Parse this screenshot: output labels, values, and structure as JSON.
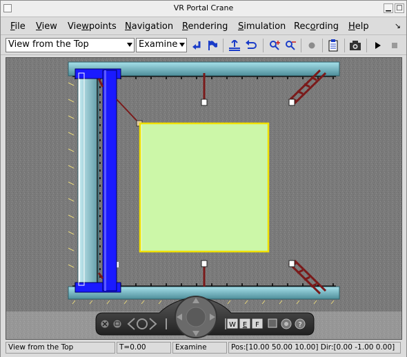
{
  "window": {
    "title": "VR Portal Crane"
  },
  "menu": {
    "file": {
      "mnemonic": "F",
      "rest": "ile"
    },
    "view": {
      "mnemonic": "V",
      "rest": "iew"
    },
    "viewpoints": {
      "pre": "Vie",
      "mnemonic": "w",
      "rest": "points"
    },
    "navigation": {
      "mnemonic": "N",
      "rest": "avigation"
    },
    "rendering": {
      "mnemonic": "R",
      "rest": "endering"
    },
    "simulation": {
      "mnemonic": "S",
      "rest": "imulation"
    },
    "recording": {
      "pre": "Rec",
      "mnemonic": "o",
      "rest": "rding"
    },
    "help": {
      "mnemonic": "H",
      "rest": "elp"
    }
  },
  "toolbar": {
    "viewpoint_select": "View from the Top",
    "navmode_select": "Examine"
  },
  "navpanel": {
    "w_label": "W",
    "e_label": "E",
    "f_label": "F",
    "help_label": "?"
  },
  "status": {
    "viewpoint": "View from the Top",
    "time": "T=0.00",
    "mode": "Examine",
    "position": "Pos:[10.00 50.00 10.00] Dir:[0.00 -1.00 0.00]"
  },
  "colors": {
    "floor": "#7a7a7a",
    "rail": "#7fc4cf",
    "crane_beam": "#1a1aff",
    "load_area": "#ccf7a8",
    "load_border": "#f0e000",
    "truss": "#7a1a1a"
  }
}
